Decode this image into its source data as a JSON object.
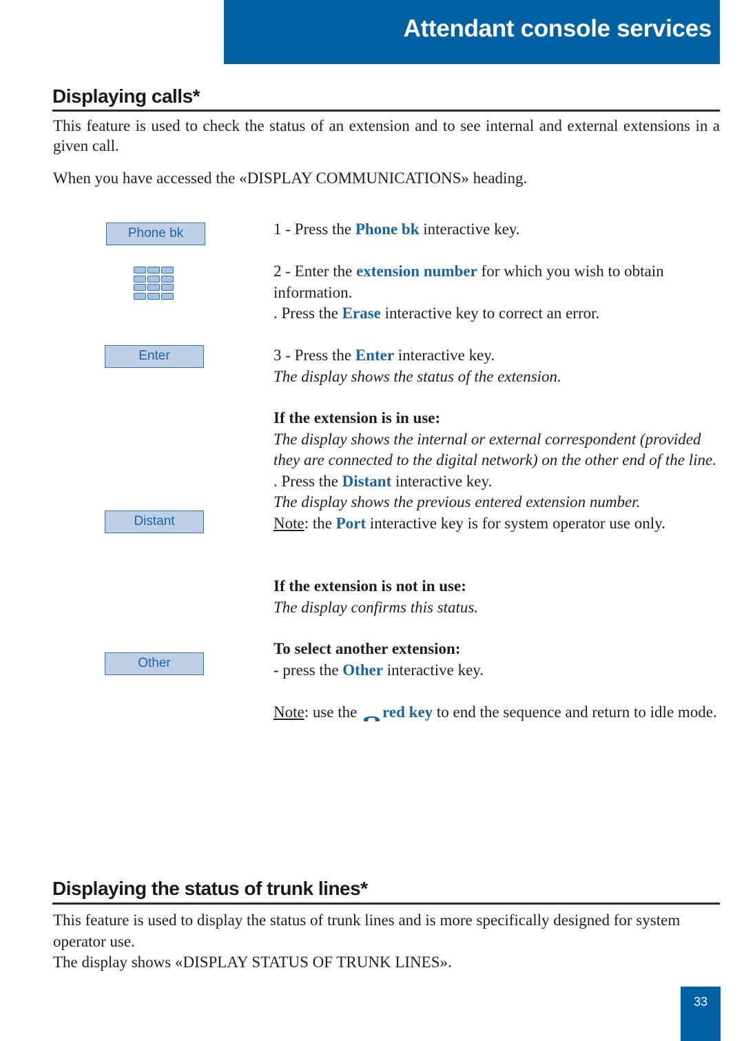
{
  "header": {
    "title": "Attendant console services"
  },
  "section1": {
    "title": "Displaying calls*",
    "intro": "This feature is used to check the status of an extension and to see internal and external extensions in a given call.",
    "context": "When you have accessed the «DISPLAY COMMUNICATIONS» heading."
  },
  "keys": {
    "phone_bk": "Phone bk",
    "enter": "Enter",
    "distant": "Distant",
    "other": "Other",
    "keypad_icon": "keypad-icon"
  },
  "steps": {
    "s1": {
      "pre": "1 - Press the ",
      "kw": "Phone bk",
      "post": " interactive key."
    },
    "s2": {
      "pre": "2 - Enter the ",
      "kw": "extension number",
      "post": " for which you wish to obtain information."
    },
    "s2b": {
      "pre": ". Press the ",
      "kw": "Erase",
      "post": " interactive key to correct an error."
    },
    "s3": {
      "pre": "3 - Press the ",
      "kw": "Enter",
      "post": " interactive key."
    },
    "s3_result": "The display shows the status of the extension.",
    "in_use": {
      "heading": "If the extension is in use:",
      "desc": "The display shows the internal or external correspondent (provided they are connected to the digital network) on the other end of the line.",
      "action": {
        "pre": ". Press the ",
        "kw": "Distant",
        "post": " interactive key."
      },
      "result": "The display shows the previous entered extension number.",
      "note": {
        "label": "Note",
        "pre": ": the ",
        "kw": "Port",
        "post": " interactive key is for system operator use only."
      }
    },
    "not_in_use": {
      "heading": "If the extension is not in use:",
      "desc": "The display confirms this status."
    },
    "select_other": {
      "heading": "To select another extension:",
      "action": {
        "pre": "- press the ",
        "kw": "Other",
        "post": " interactive key."
      }
    },
    "final_note": {
      "label": "Note",
      "pre": ": use the ",
      "icon": "hang-up-icon",
      "kw": "red key",
      "post": " to end the sequence and return to idle mode."
    }
  },
  "section2": {
    "title": "Displaying the status of trunk lines*",
    "intro": "This feature is used to display the status of trunk lines and is more specifically designed for system operator use.",
    "display": "The display shows «DISPLAY STATUS OF TRUNK LINES»."
  },
  "colors": {
    "brand_blue": "#0062a3",
    "keyword_blue": "#1862a6",
    "key_fill": "#bfcfe6"
  },
  "footer": {
    "page_number": "33"
  }
}
